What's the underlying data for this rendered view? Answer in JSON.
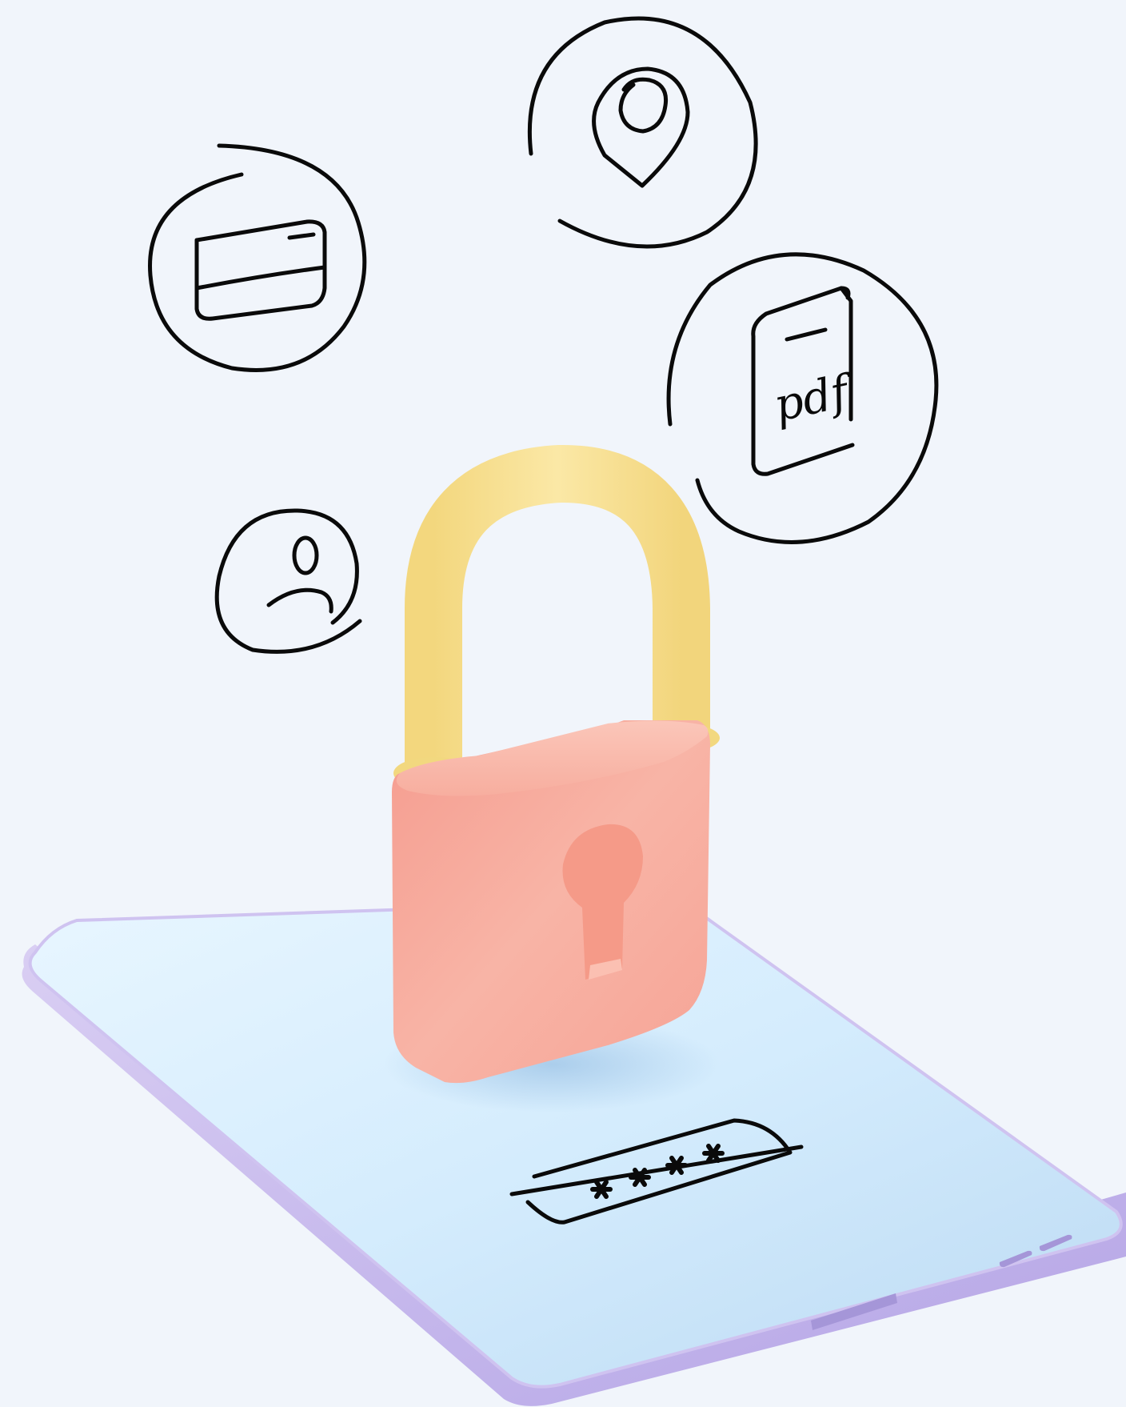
{
  "scene": {
    "description_icons": [
      "credit-card-icon",
      "location-pin-icon",
      "pdf-document-icon",
      "user-profile-icon"
    ],
    "pdf_label": "pdf",
    "password_mask": "****",
    "colors": {
      "background": "#f1f5fb",
      "line": "#0a0a0a",
      "shackle": "#f8e39a",
      "lock_body": "#f8b4a6",
      "screen_top": "#d9efff",
      "screen_bottom": "#c1def6",
      "device_frame": "#c7b9ec"
    }
  }
}
